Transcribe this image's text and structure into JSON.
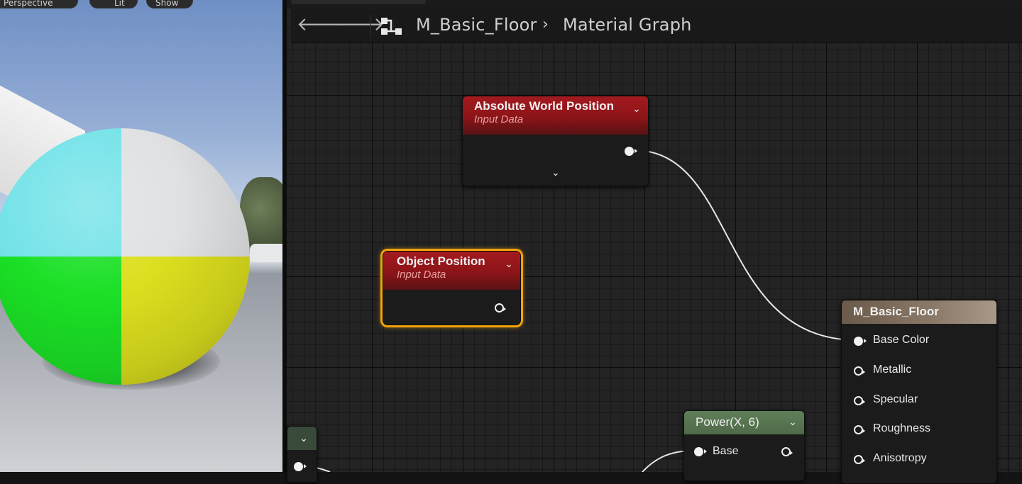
{
  "viewport": {
    "buttons": [
      "Perspective",
      "Lit",
      "Show"
    ],
    "sphere_colors": {
      "top_left": "#74e3e8",
      "top_right": "#dfe1e3",
      "bottom_left": "#1be026",
      "bottom_right": "#dcdf1e"
    }
  },
  "toolbar": {
    "back_icon": "arrow-left-icon",
    "forward_icon": "arrow-right-icon",
    "graph_icon": "material-graph-icon"
  },
  "breadcrumb": {
    "asset": "M_Basic_Floor",
    "separator": "›",
    "graph": "Material Graph"
  },
  "nodes": {
    "absolute_world_position": {
      "title": "Absolute World Position",
      "subtitle": "Input Data"
    },
    "object_position": {
      "title": "Object Position",
      "subtitle": "Input Data"
    },
    "power": {
      "title": "Power(X, 6)",
      "input_base": "Base"
    },
    "material_output": {
      "title": "M_Basic_Floor",
      "pins": [
        "Base Color",
        "Metallic",
        "Specular",
        "Roughness",
        "Anisotropy"
      ]
    }
  },
  "colors": {
    "input_node_header": "#8c1418",
    "math_node_header": "#5f7f58",
    "output_node_header": "#8c7a69",
    "selection_outline": "#f2a20c",
    "graph_background": "#232323"
  }
}
